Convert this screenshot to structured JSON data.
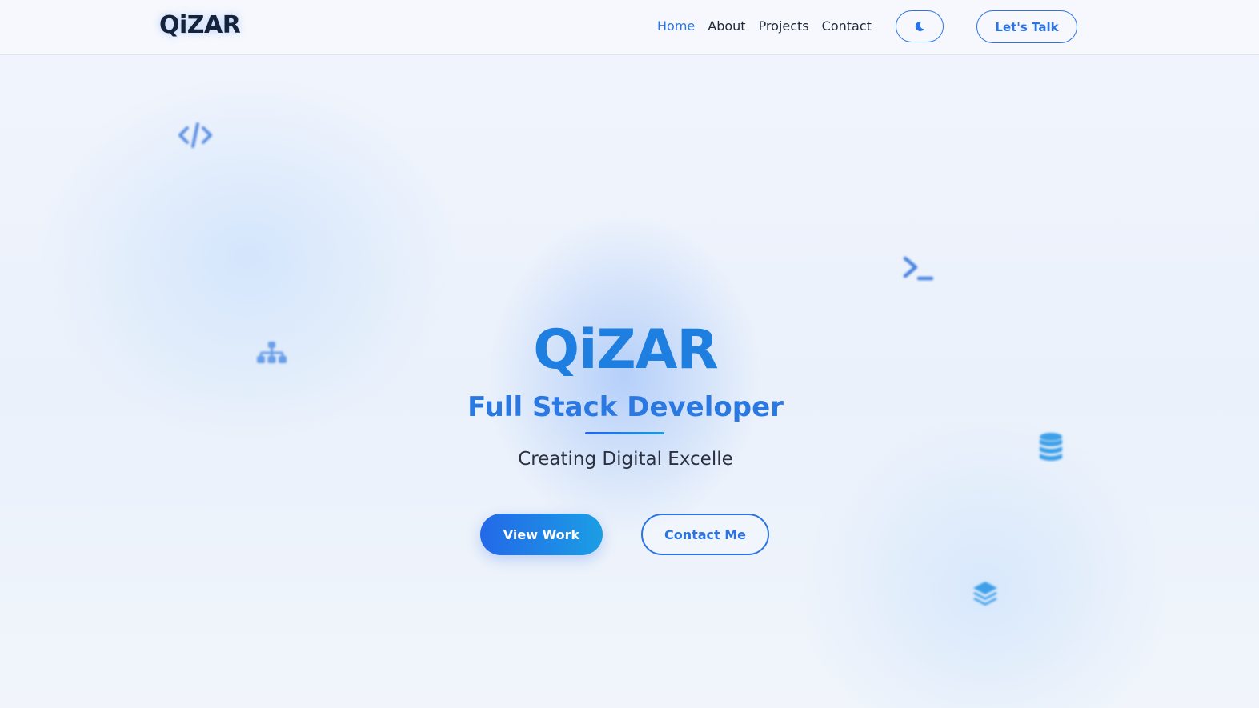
{
  "header": {
    "logo": "QiZAR",
    "nav": [
      {
        "label": "Home",
        "active": true
      },
      {
        "label": "About",
        "active": false
      },
      {
        "label": "Projects",
        "active": false
      },
      {
        "label": "Contact",
        "active": false
      }
    ],
    "theme_toggle_icon": "moon-icon",
    "cta_label": "Let's Talk"
  },
  "hero": {
    "title": "QiZAR",
    "subtitle": "Full Stack Developer",
    "tagline": "Creating Digital Excelle",
    "primary_button": "View Work",
    "secondary_button": "Contact Me"
  },
  "decorations": {
    "icons": [
      "code-icon",
      "terminal-icon",
      "sitemap-icon",
      "database-icon",
      "layers-icon"
    ]
  },
  "colors": {
    "accent": "#2b74e4",
    "title": "#1f7fe0",
    "logo": "#15223b",
    "background": "#eef3fb"
  }
}
